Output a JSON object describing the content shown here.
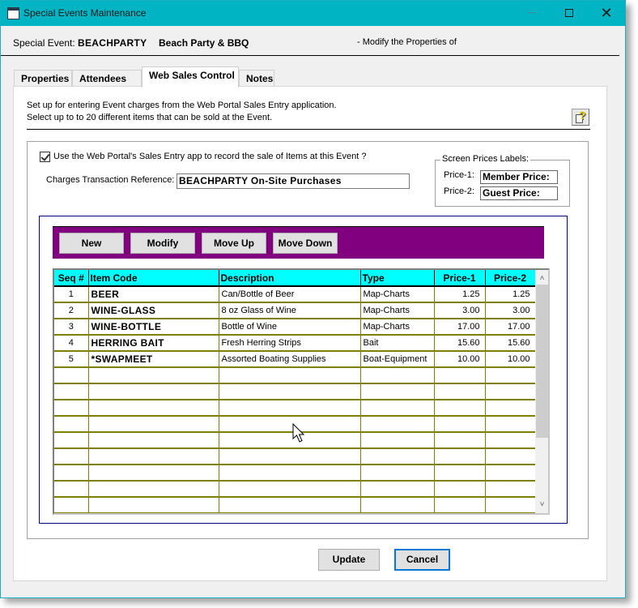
{
  "window": {
    "title": "Special Events Maintenance",
    "controls": {
      "minimize": "—",
      "maximize": "□",
      "close": "✕"
    }
  },
  "header": {
    "label": "Special Event:",
    "event_code": "BEACHPARTY",
    "event_name": "Beach Party & BBQ",
    "mode": "- Modify the Properties of"
  },
  "tabs": [
    {
      "label": "Properties",
      "active": false
    },
    {
      "label": "Attendees",
      "active": false
    },
    {
      "label": "Web Sales Control",
      "active": true
    },
    {
      "label": "Notes",
      "active": false
    }
  ],
  "panel": {
    "intro_line1": "Set up for entering Event charges from the Web Portal Sales Entry application.",
    "intro_line2": "Select up to to 20 different items that can be sold at the Event.",
    "help_icon": "help-document-icon",
    "use_web_portal": {
      "checked": true,
      "label": "Use the Web Portal's Sales Entry app to record the sale of Items at this Event ?"
    },
    "charges_reference": {
      "label": "Charges Transaction Reference:",
      "value": "BEACHPARTY On-Site Purchases"
    },
    "price_labels": {
      "legend": "Screen Prices Labels:",
      "price1_label": "Price-1:",
      "price1_value": "Member Price:",
      "price2_label": "Price-2:",
      "price2_value": "Guest Price:"
    },
    "toolbar": {
      "new": "New",
      "modify": "Modify",
      "move_up": "Move Up",
      "move_down": "Move Down",
      "bar_color": "#800080"
    },
    "grid": {
      "header_color": "#00ffff",
      "columns": [
        "Seq #",
        "Item Code",
        "Description",
        "Type",
        "Price-1",
        "Price-2"
      ],
      "rows": [
        {
          "seq": "1",
          "code": "BEER",
          "description": "Can/Bottle of Beer",
          "type": "Map-Charts",
          "price1": "1.25",
          "price2": "1.25"
        },
        {
          "seq": "2",
          "code": "WINE-GLASS",
          "description": "8 oz Glass of Wine",
          "type": "Map-Charts",
          "price1": "3.00",
          "price2": "3.00"
        },
        {
          "seq": "3",
          "code": "WINE-BOTTLE",
          "description": "Bottle of Wine",
          "type": "Map-Charts",
          "price1": "17.00",
          "price2": "17.00"
        },
        {
          "seq": "4",
          "code": "HERRING BAIT",
          "description": "Fresh Herring Strips",
          "type": "Bait",
          "price1": "15.60",
          "price2": "15.60"
        },
        {
          "seq": "5",
          "code": "*SWAPMEET",
          "description": "Assorted Boating Supplies",
          "type": "Boat-Equipment",
          "price1": "10.00",
          "price2": "10.00"
        }
      ],
      "empty_rows": 9,
      "scroll_up": "˄",
      "scroll_down": "˅"
    }
  },
  "footer": {
    "update": "Update",
    "cancel": "Cancel"
  }
}
